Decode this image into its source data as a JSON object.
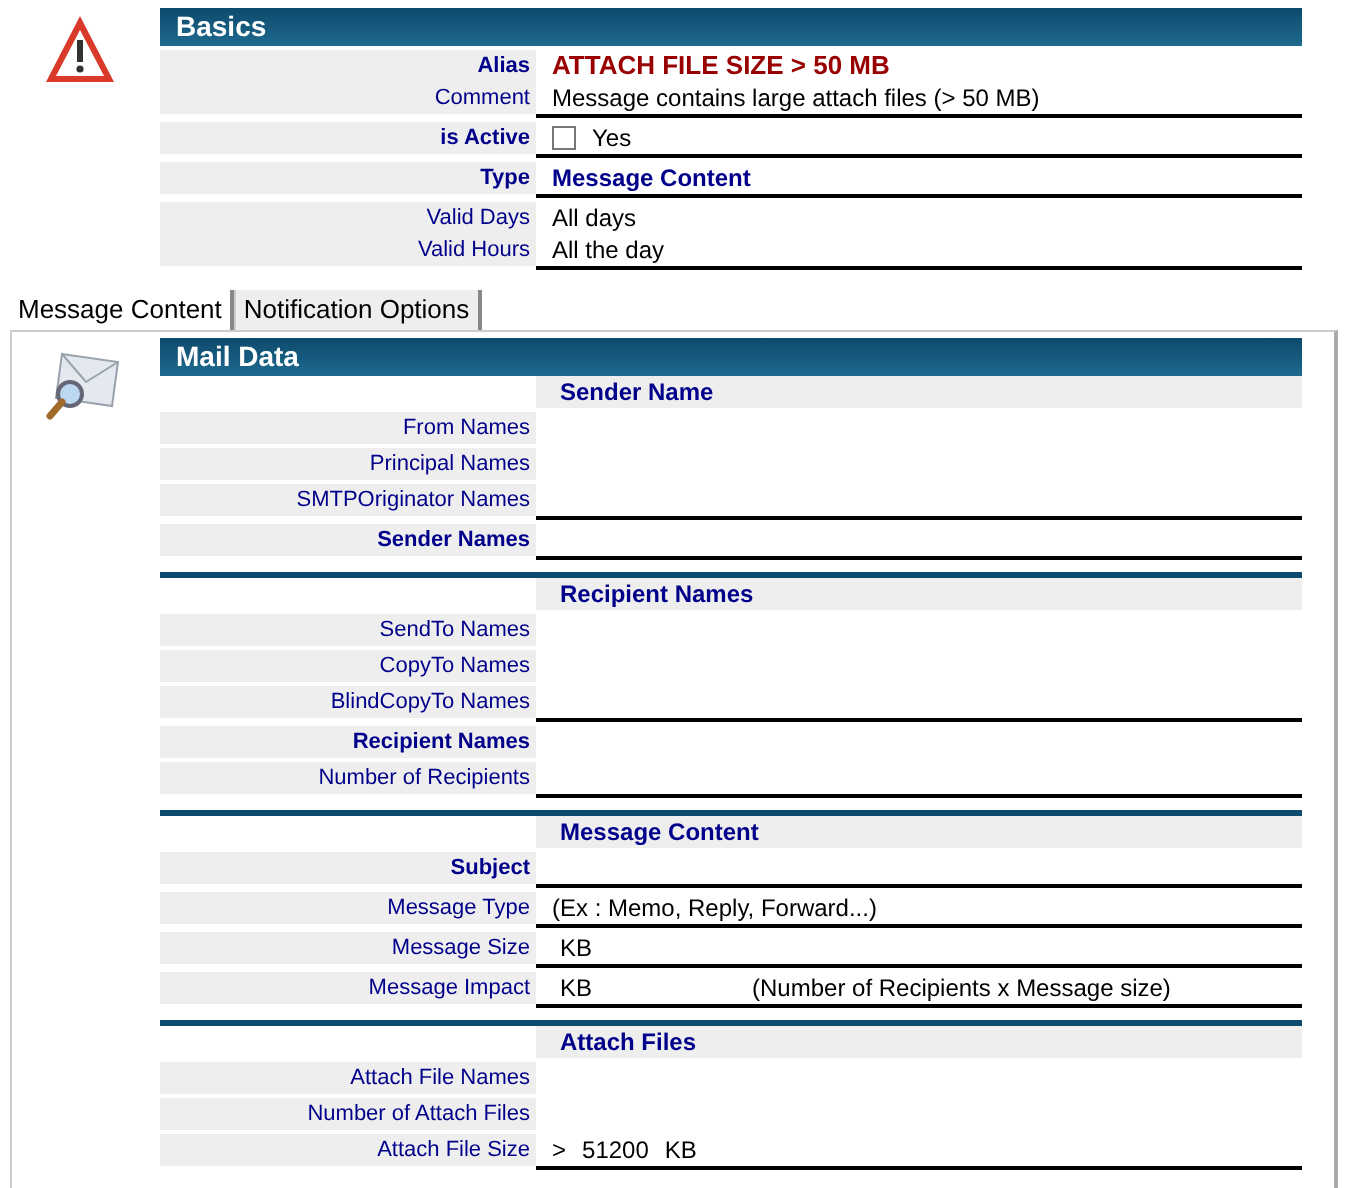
{
  "basics": {
    "title": "Basics",
    "groups": [
      {
        "rows": [
          {
            "label": "Alias",
            "bold": true,
            "values": [
              {
                "kind": "alias",
                "text": "ATTACH FILE SIZE > 50 MB"
              }
            ]
          },
          {
            "label": "Comment",
            "bold": false,
            "values": [
              {
                "kind": "text",
                "text": "Message contains large attach files (> 50 MB)"
              }
            ]
          }
        ]
      },
      {
        "rows": [
          {
            "label": "is Active",
            "bold": true,
            "values": [
              {
                "kind": "checkbox",
                "checked": false,
                "text": "Yes"
              }
            ]
          }
        ]
      },
      {
        "rows": [
          {
            "label": "Type",
            "bold": true,
            "values": [
              {
                "kind": "type",
                "text": "Message Content"
              }
            ]
          }
        ]
      },
      {
        "rows": [
          {
            "label": "Valid Days",
            "bold": false,
            "values": [
              {
                "kind": "text",
                "text": "All days"
              }
            ]
          },
          {
            "label": "Valid Hours",
            "bold": false,
            "values": [
              {
                "kind": "text",
                "text": "All the day"
              }
            ]
          }
        ]
      }
    ]
  },
  "tabs": [
    {
      "label": "Message Content",
      "selected": true
    },
    {
      "label": "Notification Options",
      "selected": false
    }
  ],
  "mail": {
    "title": "Mail Data",
    "sections": [
      {
        "title": "Sender Name",
        "groups": [
          {
            "rows": [
              {
                "label": "From Names",
                "bold": false,
                "values": []
              },
              {
                "label": "Principal Names",
                "bold": false,
                "values": []
              },
              {
                "label": "SMTPOriginator Names",
                "bold": false,
                "values": []
              }
            ]
          },
          {
            "rows": [
              {
                "label": "Sender Names",
                "bold": true,
                "values": []
              }
            ]
          }
        ]
      },
      {
        "title": "Recipient Names",
        "groups": [
          {
            "rows": [
              {
                "label": "SendTo Names",
                "bold": false,
                "values": []
              },
              {
                "label": "CopyTo Names",
                "bold": false,
                "values": []
              },
              {
                "label": "BlindCopyTo Names",
                "bold": false,
                "values": []
              }
            ]
          },
          {
            "rows": [
              {
                "label": "Recipient Names",
                "bold": true,
                "values": []
              },
              {
                "label": "Number of Recipients",
                "bold": false,
                "values": []
              }
            ]
          }
        ]
      },
      {
        "title": "Message Content",
        "groups": [
          {
            "rows": [
              {
                "label": "Subject",
                "bold": true,
                "values": []
              }
            ]
          },
          {
            "rows": [
              {
                "label": "Message Type",
                "bold": false,
                "values": [
                  {
                    "kind": "text",
                    "text": "(Ex : Memo, Reply, Forward...)"
                  }
                ]
              }
            ]
          },
          {
            "rows": [
              {
                "label": "Message Size",
                "bold": false,
                "values": [
                  {
                    "kind": "unit",
                    "text": "KB"
                  }
                ]
              }
            ]
          },
          {
            "rows": [
              {
                "label": "Message Impact",
                "bold": false,
                "values": [
                  {
                    "kind": "unit",
                    "text": "KB"
                  },
                  {
                    "kind": "note",
                    "text": "(Number of Recipients x Message size)"
                  }
                ]
              }
            ]
          }
        ]
      },
      {
        "title": "Attach Files",
        "groups": [
          {
            "rows": [
              {
                "label": "Attach File Names",
                "bold": false,
                "values": []
              },
              {
                "label": "Number of Attach Files",
                "bold": false,
                "values": []
              },
              {
                "label": "Attach File Size",
                "bold": false,
                "values": [
                  {
                    "kind": "text",
                    "text": ">"
                  },
                  {
                    "kind": "text",
                    "text": "51200"
                  },
                  {
                    "kind": "text",
                    "text": "KB"
                  }
                ]
              }
            ]
          }
        ]
      }
    ]
  }
}
